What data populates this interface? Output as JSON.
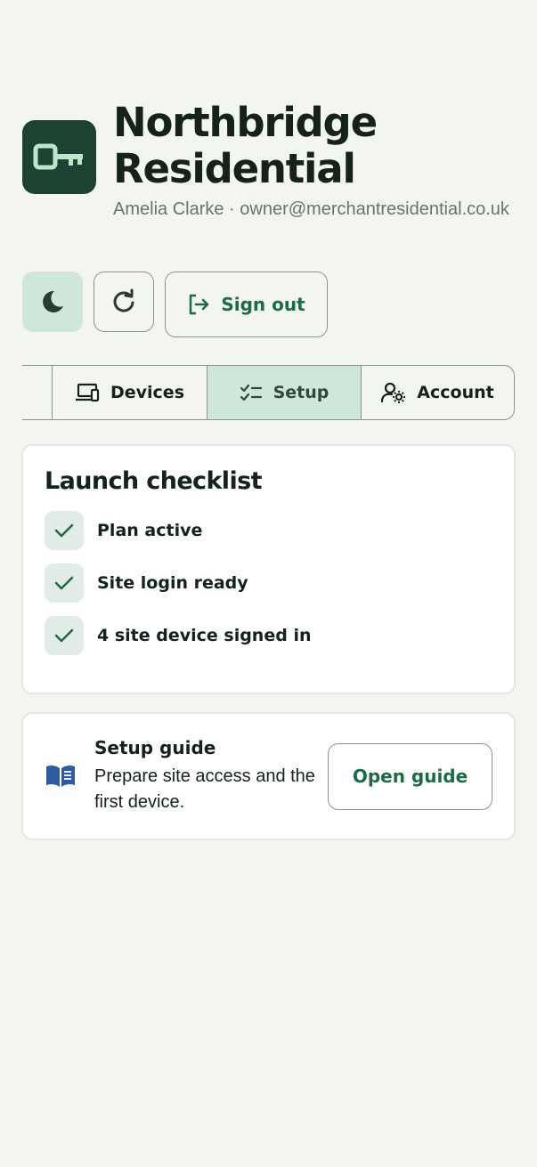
{
  "header": {
    "title": "Northbridge Residential",
    "user_line": "Amelia Clarke · owner@merchantresidential.co.uk",
    "logo_icon": "key-icon"
  },
  "actions": {
    "theme_icon": "moon-icon",
    "refresh_icon": "refresh-icon",
    "signout_label": "Sign out",
    "signout_icon": "sign-out-icon"
  },
  "tabs": [
    {
      "label": "Devices",
      "icon": "devices-icon",
      "selected": false
    },
    {
      "label": "Setup",
      "icon": "checklist-icon",
      "selected": true
    },
    {
      "label": "Account",
      "icon": "user-settings-icon",
      "selected": false
    }
  ],
  "checklist": {
    "title": "Launch checklist",
    "items": [
      {
        "label": "Plan active",
        "done": true
      },
      {
        "label": "Site login ready",
        "done": true
      },
      {
        "label": "4 site device signed in",
        "done": true
      }
    ]
  },
  "guide": {
    "icon": "book-icon",
    "title": "Setup guide",
    "description": "Prepare site access and the first device.",
    "button_label": "Open guide"
  },
  "colors": {
    "brand": "#1b4332",
    "accent": "#1d6b45",
    "selected_bg": "#cfe7d9",
    "background": "#f3f5f1"
  }
}
